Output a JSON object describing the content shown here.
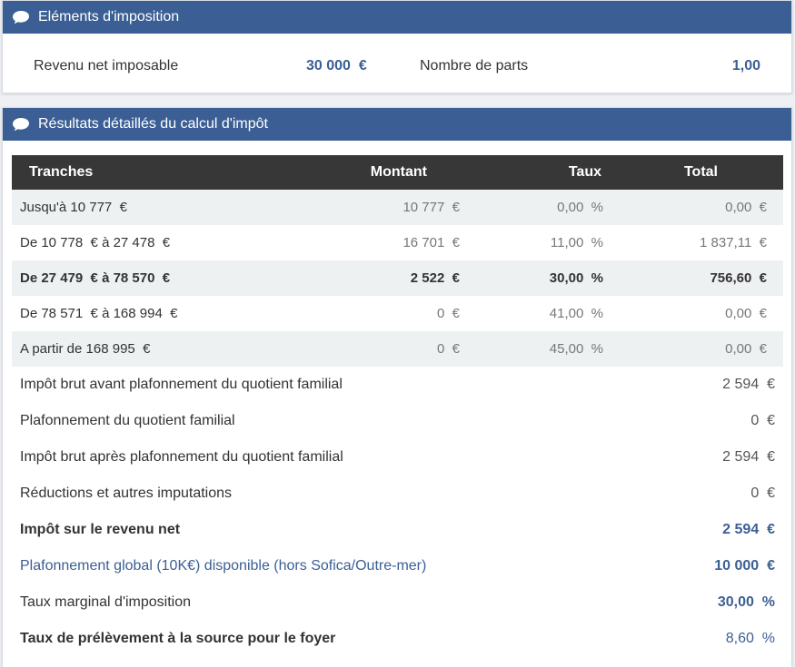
{
  "elements_panel": {
    "title": "Eléments d'imposition",
    "revenu_label": "Revenu net imposable",
    "revenu_value": "30 000  €",
    "parts_label": "Nombre de parts",
    "parts_value": "1,00"
  },
  "results_panel": {
    "title": "Résultats détaillés du calcul d'impôt",
    "columns": [
      "Tranches",
      "Montant",
      "Taux",
      "Total"
    ],
    "brackets": [
      {
        "tranche": "Jusqu'à 10 777  €",
        "montant": "10 777  €",
        "taux": "0,00  %",
        "total": "0,00  €"
      },
      {
        "tranche": "De 10 778  € à 27 478  €",
        "montant": "16 701  €",
        "taux": "11,00  %",
        "total": "1 837,11  €"
      },
      {
        "tranche": "De 27 479  € à 78 570  €",
        "montant": "2 522  €",
        "taux": "30,00  %",
        "total": "756,60  €"
      },
      {
        "tranche": "De 78 571  € à 168 994  €",
        "montant": "0  €",
        "taux": "41,00  %",
        "total": "0,00  €"
      },
      {
        "tranche": "A partir de 168 995  €",
        "montant": "0  €",
        "taux": "45,00  %",
        "total": "0,00  €"
      }
    ],
    "summary": [
      {
        "label": "Impôt brut avant plafonnement du quotient familial",
        "value": "2 594  €"
      },
      {
        "label": "Plafonnement du quotient familial",
        "value": "0  €"
      },
      {
        "label": "Impôt brut après plafonnement du quotient familial",
        "value": "2 594  €"
      },
      {
        "label": "Réductions et autres imputations",
        "value": "0  €"
      },
      {
        "label": "Impôt sur le revenu net",
        "value": "2 594  €"
      },
      {
        "label": "Plafonnement global (10K€) disponible (hors Sofica/Outre-mer)",
        "value": "10 000  €"
      },
      {
        "label": "Taux marginal d'imposition",
        "value": "30,00  %"
      },
      {
        "label": "Taux de prélèvement à la source pour le foyer",
        "value": "8,60  %"
      }
    ]
  },
  "colors": {
    "header_blue": "#3b5f94",
    "table_head": "#373737",
    "row_alt": "#eef1f1"
  },
  "icons": {
    "panel_header": "comment-icon"
  }
}
